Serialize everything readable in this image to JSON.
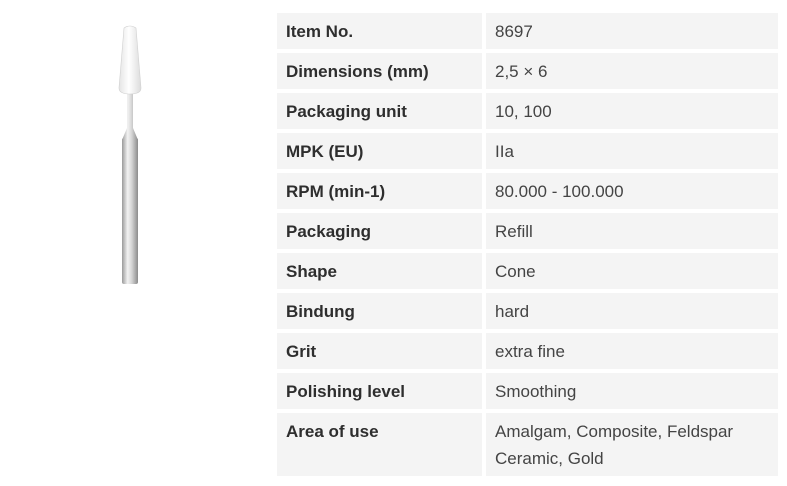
{
  "product": {
    "image_name": "polishing-cone-bur"
  },
  "specs": [
    {
      "label": "Item No.",
      "value": "8697"
    },
    {
      "label": "Dimensions (mm)",
      "value": "2,5 × 6"
    },
    {
      "label": "Packaging unit",
      "value": "10, 100"
    },
    {
      "label": "MPK (EU)",
      "value": "IIa"
    },
    {
      "label": "RPM (min-1)",
      "value": "80.000 - 100.000"
    },
    {
      "label": "Packaging",
      "value": "Refill"
    },
    {
      "label": "Shape",
      "value": "Cone"
    },
    {
      "label": "Bindung",
      "value": "hard"
    },
    {
      "label": "Grit",
      "value": "extra fine"
    },
    {
      "label": "Polishing level",
      "value": "Smoothing"
    },
    {
      "label": "Area of use",
      "value": "Amalgam, Composite, Feldspar Ceramic, Gold"
    }
  ]
}
